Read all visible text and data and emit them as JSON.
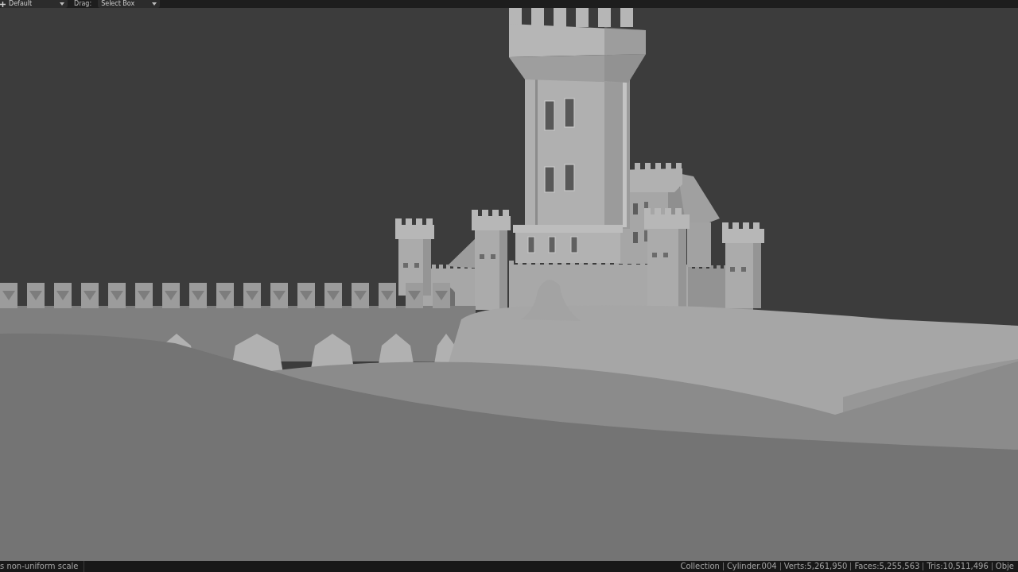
{
  "header": {
    "transform_orientation": "Default",
    "drag_label": "Drag:",
    "drag_tool": "Select Box"
  },
  "status_bar": {
    "message": "s non-uniform scale",
    "stats": [
      "Collection",
      "Cylinder.004",
      "Verts:5,261,950",
      "Faces:5,255,563",
      "Tris:10,511,496",
      "Obje"
    ]
  }
}
